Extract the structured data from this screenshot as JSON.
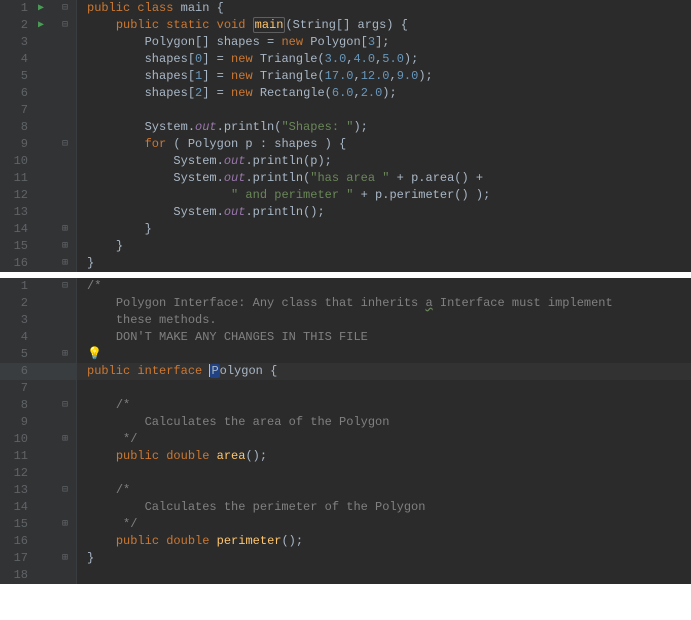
{
  "editor1": {
    "lines": [
      {
        "n": 1,
        "run": true,
        "fold": "⊟",
        "tokens": [
          [
            "kw",
            "public "
          ],
          [
            "kw",
            "class "
          ],
          [
            "cls",
            "main "
          ],
          [
            "op",
            "{"
          ]
        ]
      },
      {
        "n": 2,
        "run": true,
        "fold": "⊟",
        "indent": 1,
        "tokens": [
          [
            "kw",
            "public "
          ],
          [
            "kw",
            "static "
          ],
          [
            "kw",
            "void "
          ],
          [
            "fn-box",
            "main"
          ],
          [
            "op",
            "(String[] args) {"
          ]
        ]
      },
      {
        "n": 3,
        "indent": 2,
        "tokens": [
          [
            "type",
            "Polygon[] shapes = "
          ],
          [
            "kw",
            "new "
          ],
          [
            "type",
            "Polygon["
          ],
          [
            "num",
            "3"
          ],
          [
            "op",
            "];"
          ]
        ]
      },
      {
        "n": 4,
        "indent": 2,
        "tokens": [
          [
            "type",
            "shapes["
          ],
          [
            "num",
            "0"
          ],
          [
            "op",
            "] = "
          ],
          [
            "kw",
            "new "
          ],
          [
            "type",
            "Triangle("
          ],
          [
            "num",
            "3.0"
          ],
          [
            "op",
            ","
          ],
          [
            "num",
            "4.0"
          ],
          [
            "op",
            ","
          ],
          [
            "num",
            "5.0"
          ],
          [
            "op",
            ");"
          ]
        ]
      },
      {
        "n": 5,
        "indent": 2,
        "tokens": [
          [
            "type",
            "shapes["
          ],
          [
            "num",
            "1"
          ],
          [
            "op",
            "] = "
          ],
          [
            "kw",
            "new "
          ],
          [
            "type",
            "Triangle("
          ],
          [
            "num",
            "17.0"
          ],
          [
            "op",
            ","
          ],
          [
            "num",
            "12.0"
          ],
          [
            "op",
            ","
          ],
          [
            "num",
            "9.0"
          ],
          [
            "op",
            ");"
          ]
        ]
      },
      {
        "n": 6,
        "indent": 2,
        "tokens": [
          [
            "type",
            "shapes["
          ],
          [
            "num",
            "2"
          ],
          [
            "op",
            "] = "
          ],
          [
            "kw",
            "new "
          ],
          [
            "type",
            "Rectangle("
          ],
          [
            "num",
            "6.0"
          ],
          [
            "op",
            ","
          ],
          [
            "num",
            "2.0"
          ],
          [
            "op",
            ");"
          ]
        ]
      },
      {
        "n": 7,
        "indent": 0,
        "tokens": []
      },
      {
        "n": 8,
        "indent": 2,
        "tokens": [
          [
            "type",
            "System."
          ],
          [
            "fld",
            "out"
          ],
          [
            "op",
            "."
          ],
          [
            "type",
            "println("
          ],
          [
            "str",
            "\"Shapes: \""
          ],
          [
            "op",
            ");"
          ]
        ]
      },
      {
        "n": 9,
        "fold": "⊟",
        "indent": 2,
        "tokens": [
          [
            "kw",
            "for "
          ],
          [
            "op",
            "( Polygon p : shapes ) {"
          ]
        ]
      },
      {
        "n": 10,
        "indent": 3,
        "tokens": [
          [
            "type",
            "System."
          ],
          [
            "fld",
            "out"
          ],
          [
            "op",
            "."
          ],
          [
            "type",
            "println(p);"
          ]
        ]
      },
      {
        "n": 11,
        "indent": 3,
        "tokens": [
          [
            "type",
            "System."
          ],
          [
            "fld",
            "out"
          ],
          [
            "op",
            "."
          ],
          [
            "type",
            "println("
          ],
          [
            "str",
            "\"has area \""
          ],
          [
            "op",
            " + p.area() +"
          ]
        ]
      },
      {
        "n": 12,
        "indent": 5,
        "tokens": [
          [
            "str",
            "\" and perimeter \""
          ],
          [
            "op",
            " + p.perimeter() );"
          ]
        ]
      },
      {
        "n": 13,
        "indent": 3,
        "tokens": [
          [
            "type",
            "System."
          ],
          [
            "fld",
            "out"
          ],
          [
            "op",
            "."
          ],
          [
            "type",
            "println();"
          ]
        ]
      },
      {
        "n": 14,
        "fold": "⊞",
        "indent": 2,
        "tokens": [
          [
            "op",
            "}"
          ]
        ]
      },
      {
        "n": 15,
        "fold": "⊞",
        "indent": 1,
        "tokens": [
          [
            "op",
            "}"
          ]
        ]
      },
      {
        "n": 16,
        "fold": "⊞",
        "indent": 0,
        "tokens": [
          [
            "op",
            "}"
          ]
        ]
      }
    ]
  },
  "editor2": {
    "lines": [
      {
        "n": 1,
        "fold": "⊟",
        "indent": 0,
        "tokens": [
          [
            "cmt",
            "/*"
          ]
        ]
      },
      {
        "n": 2,
        "indent": 1,
        "tokens": [
          [
            "cmt",
            "Polygon Interface: Any class that inherits "
          ],
          [
            "cmt-u",
            "a"
          ],
          [
            "cmt",
            " Interface must implement"
          ]
        ]
      },
      {
        "n": 3,
        "indent": 1,
        "tokens": [
          [
            "cmt",
            "these methods."
          ]
        ]
      },
      {
        "n": 4,
        "indent": 1,
        "tokens": [
          [
            "cmt",
            "DON'T MAKE ANY CHANGES IN THIS FILE"
          ]
        ]
      },
      {
        "n": 5,
        "fold": "⊞",
        "indent": 0,
        "bulb": true,
        "tokens": [
          [
            "ital",
            " "
          ]
        ]
      },
      {
        "n": 6,
        "hl": true,
        "indent": 0,
        "tokens": [
          [
            "kw",
            "public "
          ],
          [
            "kw",
            "interface "
          ],
          [
            "cursor",
            ""
          ],
          [
            "sel",
            "P"
          ],
          [
            "type",
            "olygon "
          ],
          [
            "op",
            "{"
          ]
        ]
      },
      {
        "n": 7,
        "indent": 0,
        "tokens": []
      },
      {
        "n": 8,
        "fold": "⊟",
        "indent": 1,
        "tokens": [
          [
            "cmt",
            "/*"
          ]
        ]
      },
      {
        "n": 9,
        "indent": 2,
        "tokens": [
          [
            "cmt",
            "Calculates the area of the Polygon"
          ]
        ]
      },
      {
        "n": 10,
        "fold": "⊞",
        "indent": 1,
        "tokens": [
          [
            "cmt",
            " */"
          ]
        ]
      },
      {
        "n": 11,
        "indent": 1,
        "tokens": [
          [
            "kw",
            "public "
          ],
          [
            "kw",
            "double "
          ],
          [
            "fn",
            "area"
          ],
          [
            "op",
            "();"
          ]
        ]
      },
      {
        "n": 12,
        "indent": 0,
        "tokens": []
      },
      {
        "n": 13,
        "fold": "⊟",
        "indent": 1,
        "tokens": [
          [
            "cmt",
            "/*"
          ]
        ]
      },
      {
        "n": 14,
        "indent": 2,
        "tokens": [
          [
            "cmt",
            "Calculates the perimeter of the Polygon"
          ]
        ]
      },
      {
        "n": 15,
        "fold": "⊞",
        "indent": 1,
        "tokens": [
          [
            "cmt",
            " */"
          ]
        ]
      },
      {
        "n": 16,
        "indent": 1,
        "tokens": [
          [
            "kw",
            "public "
          ],
          [
            "kw",
            "double "
          ],
          [
            "fn",
            "perimeter"
          ],
          [
            "op",
            "();"
          ]
        ]
      },
      {
        "n": 17,
        "fold": "⊞",
        "indent": 0,
        "tokens": [
          [
            "op",
            "}"
          ]
        ]
      },
      {
        "n": 18,
        "indent": 0,
        "tokens": []
      }
    ]
  }
}
